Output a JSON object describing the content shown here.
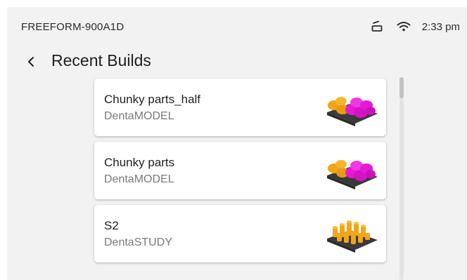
{
  "status": {
    "device_name": "FREEFORM-900A1D",
    "time": "2:33 pm"
  },
  "header": {
    "title": "Recent Builds"
  },
  "builds": [
    {
      "name": "Chunky parts_half",
      "material": "DentaMODEL",
      "thumbnail": "pink-orange-models"
    },
    {
      "name": "Chunky parts",
      "material": "DentaMODEL",
      "thumbnail": "pink-orange-models"
    },
    {
      "name": "S2",
      "material": "DentaSTUDY",
      "thumbnail": "orange-study-models"
    }
  ],
  "colors": {
    "background": "#f2f2f2",
    "card": "#ffffff",
    "accent_pink": "#e619d6",
    "accent_orange": "#f2a517",
    "platform": "#3a3a3a"
  }
}
